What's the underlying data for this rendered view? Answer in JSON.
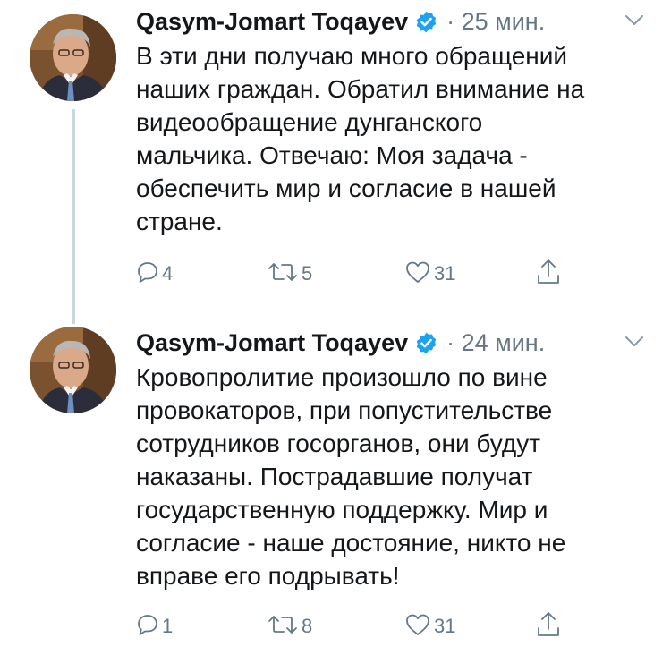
{
  "tweets": [
    {
      "author": "Qasym-Jomart Toqayev",
      "time": "· 25 мин.",
      "text": "В эти дни получаю много обращений\nнаших граждан. Обратил внимание на\nвидеообращение дунганского\nмальчика. Отвечаю: Моя задача -\nобеспечить мир и согласие в нашей\nстране.",
      "replies": "4",
      "retweets": "5",
      "likes": "31"
    },
    {
      "author": "Qasym-Jomart Toqayev",
      "time": "· 24 мин.",
      "text": "Кровопролитие произошло по вине\nпровокаторов, при попустительстве\nсотрудников госорганов, они будут\nнаказаны. Пострадавшие получат\nгосударственную поддержку. Мир и\nсогласие - наше достояние, никто не\nвправе его подрывать!",
      "replies": "1",
      "retweets": "8",
      "likes": "31"
    }
  ],
  "icons": {
    "verified": "verified-badge-icon",
    "caret": "chevron-down-icon",
    "reply": "reply-icon",
    "retweet": "retweet-icon",
    "like": "heart-icon",
    "share": "share-icon"
  },
  "colors": {
    "verified": "#1da1f2",
    "meta": "#657786",
    "thread_line": "#ccd6dd"
  }
}
